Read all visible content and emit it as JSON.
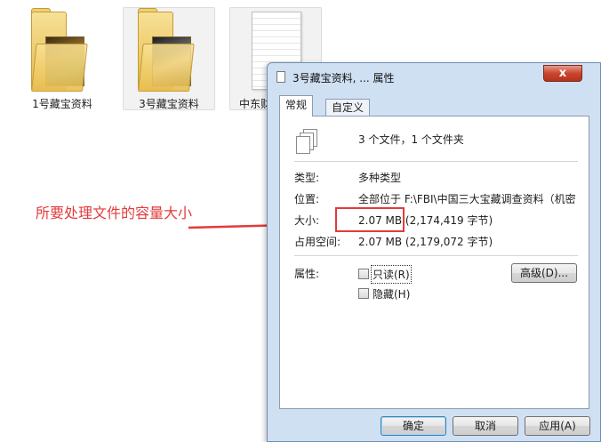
{
  "explorer": {
    "items": [
      {
        "label": "1号藏宝资料",
        "icon": "folder-icon"
      },
      {
        "label": "3号藏宝资料",
        "icon": "folder-icon"
      },
      {
        "label": "中东财",
        "icon": "document-icon"
      }
    ]
  },
  "annotation": {
    "text": "所要处理文件的容量大小",
    "color": "#e23b3b"
  },
  "dialog": {
    "title": "3号藏宝资料, ... 属性",
    "close_label": "x",
    "tabs": [
      {
        "label": "常规",
        "active": true
      },
      {
        "label": "自定义",
        "active": false
      }
    ],
    "summary": "3 个文件，1 个文件夹",
    "fields": [
      {
        "label": "类型:",
        "value": "多种类型"
      },
      {
        "label": "位置:",
        "value": "全部位于 F:\\FBI\\中国三大宝藏调查资料（机密"
      },
      {
        "label": "大小:",
        "value": "2.07 MB (2,174,419 字节)"
      },
      {
        "label": "占用空间:",
        "value": "2.07 MB (2,179,072 字节)"
      }
    ],
    "attributes": {
      "label": "属性:",
      "readonly": {
        "label": "只读(R)",
        "checked": false
      },
      "hidden": {
        "label": "隐藏(H)",
        "checked": false
      },
      "advanced_button": "高级(D)..."
    },
    "buttons": {
      "ok": "确定",
      "cancel": "取消",
      "apply": "应用(A)"
    }
  },
  "colors": {
    "accent": "#e23b3b",
    "dialog_frame": "#cfe0f3",
    "close_button": "#c9452e"
  }
}
